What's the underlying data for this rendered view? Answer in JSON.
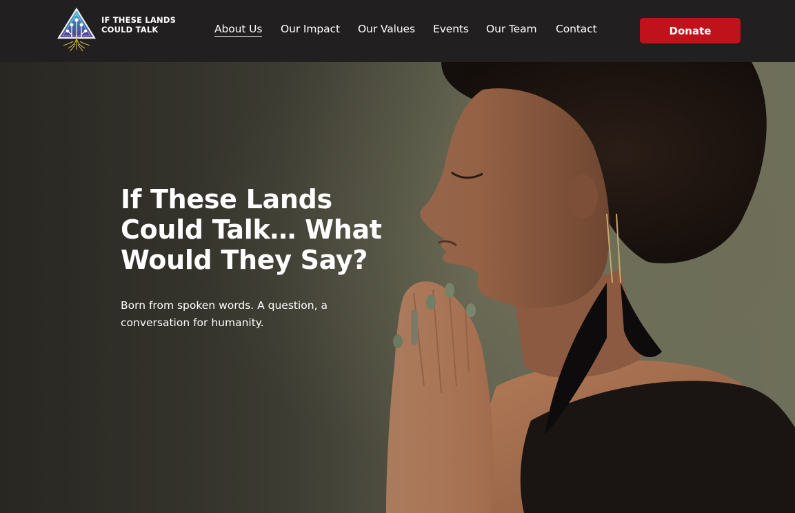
{
  "brand": {
    "name_line1": "IF THESE LANDS",
    "name_line2": "COULD TALK",
    "logo_icon": "triangle-circuit-roots-icon"
  },
  "nav": {
    "items": [
      {
        "label": "About Us",
        "active": true
      },
      {
        "label": "Our Impact",
        "active": false
      },
      {
        "label": "Our Values",
        "active": false
      },
      {
        "label": "Events",
        "active": false
      },
      {
        "label": "Our Team",
        "active": false
      },
      {
        "label": "Contact",
        "active": false
      }
    ],
    "donate_label": "Donate"
  },
  "hero": {
    "title": "If These Lands Could Talk… What Would They Say?",
    "subtitle": "Born from spoken words. A question, a conversation for humanity.",
    "photo": "woman-praying-with-feather-earring"
  },
  "colors": {
    "header_bg": "#221f20",
    "donate_bg": "#c0121a",
    "text": "#ffffff",
    "hero_bg": "#5f5f4c"
  }
}
